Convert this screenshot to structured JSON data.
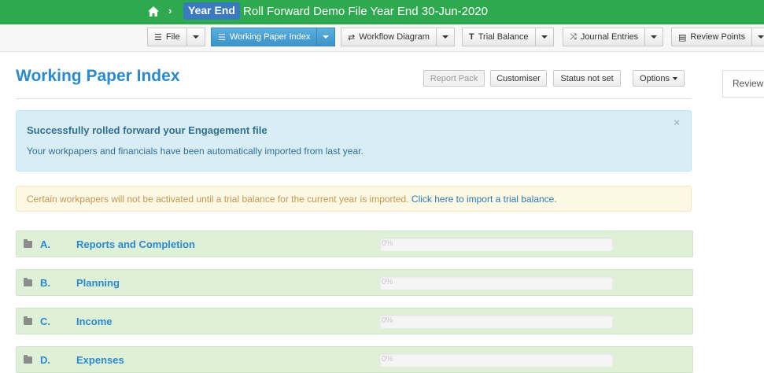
{
  "topbar": {
    "year_badge": "Year End",
    "file_title": "Roll Forward Demo File  Year End 30-Jun-2020",
    "chevron": "›"
  },
  "toolbar": {
    "file": "File",
    "wpi": "Working Paper Index",
    "workflow": "Workflow Diagram",
    "trial_balance": "Trial Balance",
    "journal_entries": "Journal Entries",
    "review_points": "Review Points"
  },
  "header": {
    "title": "Working Paper Index",
    "report_pack": "Report Pack",
    "customiser": "Customiser",
    "status": "Status not set",
    "options": "Options"
  },
  "review_tab": "Review",
  "alert_info": {
    "heading": "Successfully rolled forward your Engagement file",
    "body": "Your workpapers and financials have been automatically imported from last year.",
    "close": "×"
  },
  "alert_warn": {
    "text": "Certain workpapers will not be activated until a trial balance for the current year is imported.",
    "link": "Click here to import a trial balance."
  },
  "sections": [
    {
      "letter": "A.",
      "name": "Reports and Completion",
      "progress_label": "0%",
      "progress": 0
    },
    {
      "letter": "B.",
      "name": "Planning",
      "progress_label": "0%",
      "progress": 0
    },
    {
      "letter": "C.",
      "name": "Income",
      "progress_label": "0%",
      "progress": 0
    },
    {
      "letter": "D.",
      "name": "Expenses",
      "progress_label": "0%",
      "progress": 0
    }
  ],
  "colors": {
    "topbar": "#2ea94f",
    "accent": "#2a8ad0",
    "info_bg": "#d9edf7",
    "warn_bg": "#fcf8e3",
    "section_bg": "#dff0d8"
  }
}
